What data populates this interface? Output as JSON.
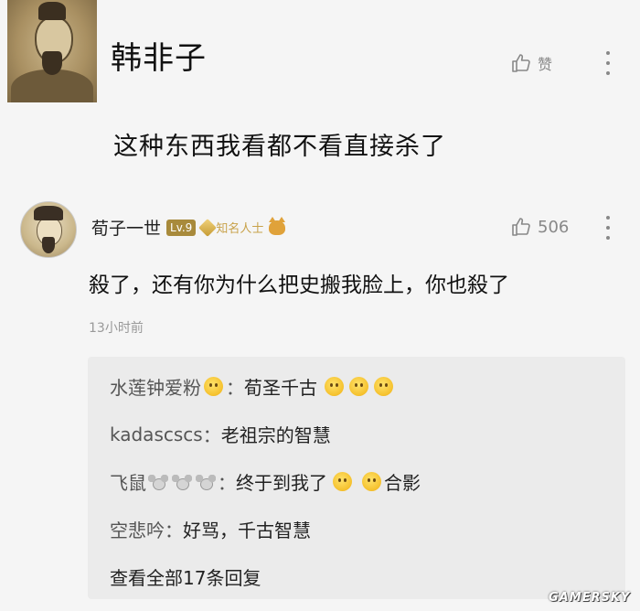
{
  "post": {
    "author": "韩非子",
    "like_label": "赞",
    "text": "这种东西我看都不看直接杀了"
  },
  "reply": {
    "name": "荀子一世",
    "level": "Lv.9",
    "vip_label": "知名人士",
    "like_count": "506",
    "text": "殺了，还有你为什么把史搬我脸上，你也殺了",
    "time": "13小时前"
  },
  "sub_replies": [
    {
      "name": "水莲钟爱粉",
      "colon": "：",
      "text": "荀圣千古",
      "text_after": ""
    },
    {
      "name": "kadascscs",
      "colon": "：",
      "text": "老祖宗的智慧",
      "text_after": ""
    },
    {
      "name": "飞鼠",
      "colon": "：",
      "text": "终于到我了",
      "text_after": "合影"
    },
    {
      "name": "空悲吟",
      "colon": "：",
      "text": "好骂，千古智慧",
      "text_after": ""
    }
  ],
  "view_all": "查看全部17条回复",
  "watermark": "GAMERSKY",
  "icons": {
    "like": "thumbs-up-icon",
    "menu": "more-vertical-icon",
    "emoji": "emoji-face-icon",
    "mouse": "mouse-emoji-icon"
  },
  "colors": {
    "background": "#f5f5f5",
    "sub_box": "#ebebeb",
    "level_badge": "#a88a3b",
    "vip_gold": "#c8a24a",
    "muted": "#888888"
  }
}
